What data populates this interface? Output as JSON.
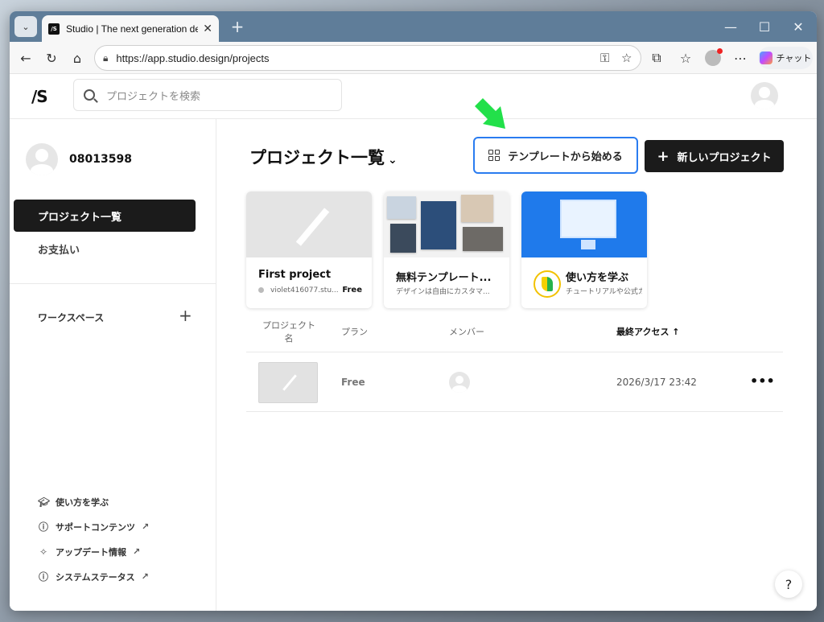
{
  "browser": {
    "tab_title": "Studio | The next generation design tool",
    "url": "https://app.studio.design/projects",
    "copilot_label": "チャット"
  },
  "app": {
    "logo": "/S",
    "search_placeholder": "プロジェクトを検索"
  },
  "sidebar": {
    "username": "08013598",
    "nav": [
      {
        "label": "プロジェクト一覧"
      },
      {
        "label": "お支払い"
      }
    ],
    "workspace_label": "ワークスペース",
    "links": [
      {
        "label": "使い方を学ぶ",
        "icon": "graduation-cap-icon"
      },
      {
        "label": "サポートコンテンツ",
        "icon": "question-circle-icon"
      },
      {
        "label": "アップデート情報",
        "icon": "sparkle-icon"
      },
      {
        "label": "システムステータス",
        "icon": "info-circle-icon"
      }
    ]
  },
  "main": {
    "title": "プロジェクト一覧",
    "template_button": "テンプレートから始める",
    "new_button": "新しいプロジェクト",
    "cards": [
      {
        "title": "First project",
        "subtitle": "violet416077.stu...",
        "plan": "Free"
      },
      {
        "title": "無料テンプレート...",
        "subtitle": "デザインは自由にカスタマ..."
      },
      {
        "title": "使い方を学ぶ",
        "subtitle": "チュートリアルや公式カ"
      }
    ],
    "table": {
      "headers": [
        "プロジェクト名",
        "プラン",
        "メンバー",
        "最終アクセス"
      ],
      "sort_indicator": "↑",
      "rows": [
        {
          "plan": "Free",
          "last_access": "2026/3/17 23:42"
        }
      ]
    }
  },
  "accent_color": "#2a7cf0",
  "arrow_color": "#22e04a"
}
